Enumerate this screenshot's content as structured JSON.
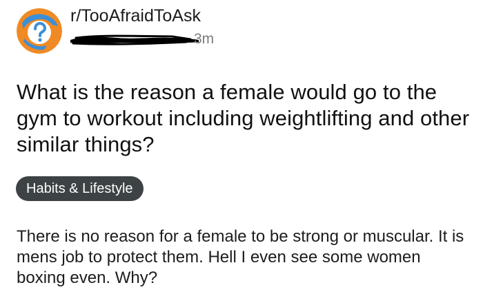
{
  "post": {
    "subreddit": "r/TooAfraidToAsk",
    "timestamp": "3m",
    "title": "What is the reason a female would go to the gym to workout including weightlifting and other similar things?",
    "flair": "Habits & Lifestyle",
    "body": "There is no reason for a female to be strong or muscular. It is mens job to protect them. Hell I even see some women boxing even. Why?"
  },
  "icons": {
    "avatar": "subreddit-question-mark-icon",
    "redaction": "redacted-username-scribble"
  },
  "colors": {
    "avatar_orange": "#f08a24",
    "avatar_blue": "#3b8fd6",
    "flair_bg": "#3d4244",
    "flair_text": "#ffffff",
    "timestamp": "#7c7c7c",
    "redaction": "#000000"
  }
}
